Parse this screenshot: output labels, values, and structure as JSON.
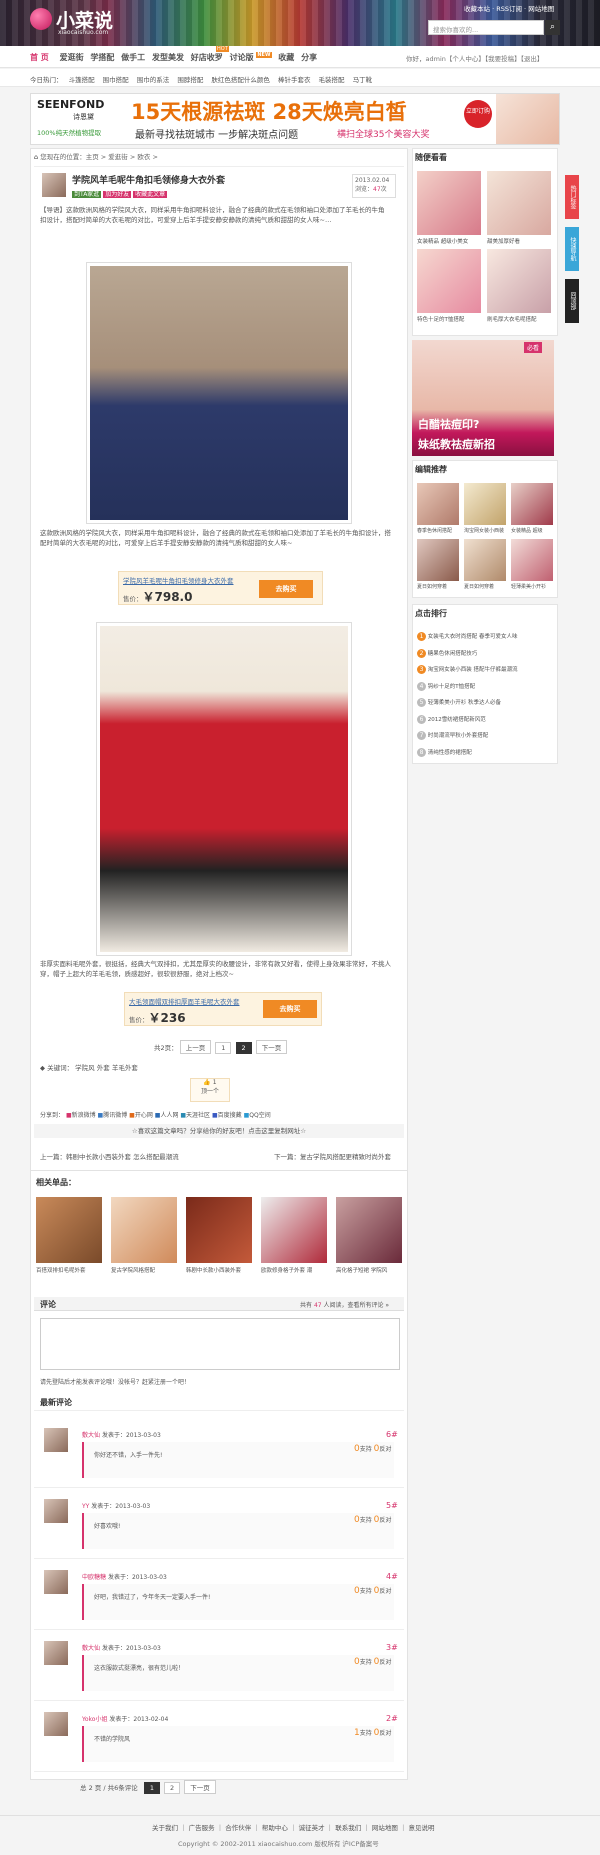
{
  "site": {
    "logo_cn": "小菜说",
    "logo_en": "xiaocaishuo.com",
    "links": [
      "收藏本站",
      "RSS订阅",
      "网站地图"
    ],
    "search_placeholder": "搜索你喜欢的..."
  },
  "nav": {
    "items": [
      "首 页",
      "爱逛街",
      "学搭配",
      "做手工",
      "发型美发",
      "好店收罗",
      "讨论版",
      "收藏",
      "分享"
    ],
    "new_badge": "NEW",
    "hot_badge": "HOT",
    "user": "你好，admin【个人中心】【我要投稿】【退出】"
  },
  "hot": {
    "label": "今日热门：",
    "items": [
      "斗篷搭配",
      "围巾搭配",
      "围巾的系法",
      "围脖搭配",
      "肤红色搭配什么颜色",
      "棒针手套衣",
      "毛装搭配",
      "马丁靴"
    ]
  },
  "banner": {
    "brand": "SEENFOND",
    "brand_cn": "诗恩黛",
    "brand_sub": "100%纯天然植物提取",
    "headline": "15天根源祛斑  28天焕亮白皙",
    "sub": "最新寻找祛斑城市 一步解决斑点问题",
    "sub_red": "横扫全球35个美容大奖",
    "cta": "立即订购"
  },
  "breadcrumb": "您现在的位置：主页 > 爱逛街 > 欧衣 >",
  "article": {
    "title": "学院风羊毛呢牛角扣毛领修身大衣外套",
    "tags": [
      "到TA家逛",
      "加为好友",
      "收藏此文章"
    ],
    "date": "2013.02.04",
    "views_label": "浏览：",
    "views": "47",
    "views_unit": "次",
    "intro": "【导语】这款欧洲风格的学院风大衣，同样采用牛角扣呢料设计，融合了经典的款式在毛领和袖口处添加了羊毛长的牛角扣设计，搭配时简单的大衣毛呢的对比，可爱穿上后羊手提安静安静款的清纯气质和甜甜的女人味~…",
    "p1": "这款欧洲风格的学院风大衣，同样采用牛角扣呢料设计，融合了经典的款式在毛领和袖口处添加了羊毛长的牛角扣设计，搭配时简单的大衣毛呢的对比，可爱穿上后羊手提安静安静款的清纯气质和甜甜的女人味~",
    "buy1_name": "学院风羊毛呢牛角扣毛领修身大衣外套",
    "buy1_price_label": "售价：",
    "buy1_price": "￥798.0",
    "buy_btn": "去购买",
    "p2": "非厚实面料毛呢外套，很挺括，经典大气双排扣，尤其是厚实的收腰设计，非常有款又好看，使得上身效果非常好，不挑人穿，帽子上超大的羊毛毛领，质感超好，很软很舒服，绝对上档次~",
    "buy2_name": "大毛领面帽双排扣厚面羊毛呢大衣外套",
    "buy2_price": "￥236",
    "pages": [
      "共2页：",
      "上一页",
      "1",
      "2",
      "下一页"
    ],
    "keywords_label": "关键词：",
    "keywords": [
      "学院风",
      "外套",
      "羊毛外套"
    ],
    "like": "1",
    "like_label": "顶一个",
    "share_label": "分享到：",
    "share": [
      "新浪微博",
      "腾讯微博",
      "开心网",
      "人人网",
      "天涯社区",
      "百度搜藏",
      "QQ空间"
    ],
    "copy_note": "☆喜欢这篇文章吗？分享给你的好友吧！点击这里复制网址☆",
    "prev": "上一篇：韩剧中长款小西装外套 怎么搭配最潮流",
    "next": "下一篇：复古学院风搭配更精致时尚外套"
  },
  "related": {
    "title": "相关单品：",
    "items": [
      "百搭双排扣毛呢外套",
      "复古学院风格搭配",
      "韩剧中长款小西装外套",
      "欧款修身格子外套 潮",
      "高化格子短裙 学院风"
    ]
  },
  "comment": {
    "title": "评论",
    "count_prefix": "共有",
    "count": "47",
    "count_suffix": "人阅读，查看所有评论 »",
    "login_note": "请先登陆后才能发表评论哦！没帐号？赶紧注册一个吧！",
    "latest": "最新评论",
    "support": "支持",
    "oppose": "反对",
    "items": [
      {
        "user": "敷大仙",
        "time": "发表于：2013-03-03",
        "floor": "6#",
        "text": "你好还不错，入手一件先!",
        "up": "0",
        "down": "0"
      },
      {
        "user": "YY",
        "time": "发表于：2013-03-03",
        "floor": "5#",
        "text": "好喜欢哦!",
        "up": "0",
        "down": "0"
      },
      {
        "user": "中欧糖糖",
        "time": "发表于：2013-03-03",
        "floor": "4#",
        "text": "好吧，我错过了，今年冬天一定要入手一件!",
        "up": "0",
        "down": "0"
      },
      {
        "user": "敷大仙",
        "time": "发表于：2013-03-03",
        "floor": "3#",
        "text": "这衣服款式挺漂亮，很有范儿啦！",
        "up": "0",
        "down": "0"
      },
      {
        "user": "Yoko小姐",
        "time": "发表于：2013-02-04",
        "floor": "2#",
        "text": "不错的学院风",
        "up": "1",
        "down": "0"
      }
    ],
    "pager": "总 2 页 / 共6条评论",
    "pages": [
      "1",
      "2",
      "下一页"
    ]
  },
  "sidebar": {
    "hot_title": "随便看看",
    "hot": [
      "女装精品 超级小美女",
      "甜美加厚好看",
      "女装精品 超级小美女",
      "特色十足的T恤搭配",
      "刷毛厚大衣毛呢搭配"
    ],
    "ad_text1": "白醋祛痘印?",
    "ad_text2": "妹纸教祛痘新招",
    "ad_tag": "必看",
    "edit_title": "编辑推荐",
    "edit": [
      "春季色休闲搭配",
      "淘宝网女装小西装",
      "女装精品 超级",
      "夏日如何穿着",
      "夏日如何穿着",
      "轻薄柔美小开衫"
    ],
    "rank_title": "点击排行",
    "rank": [
      "女装毛大衣时尚搭配 春季可爱女人味",
      "糖果色休闲搭配技巧",
      "淘宝网女装小西装 搭配牛仔裤最潮流",
      "钩纱十足的T恤搭配",
      "轻薄柔美小开衫 秋季达人必备",
      "2012雪纺裙搭配新风范",
      "时尚潮流早秋小外套搭配",
      "清纯性感的裙搭配"
    ],
    "float": [
      "热门标签",
      "快速导航",
      "回顶部"
    ]
  },
  "footer": {
    "links": [
      "关于我们",
      "广告服务",
      "合作伙伴",
      "帮助中心",
      "诚征英才",
      "联系我们",
      "网站地图",
      "意见说明"
    ],
    "copyright": "Copyright © 2002-2011 xiaocaishuo.com 版权所有 沪ICP备案号"
  }
}
